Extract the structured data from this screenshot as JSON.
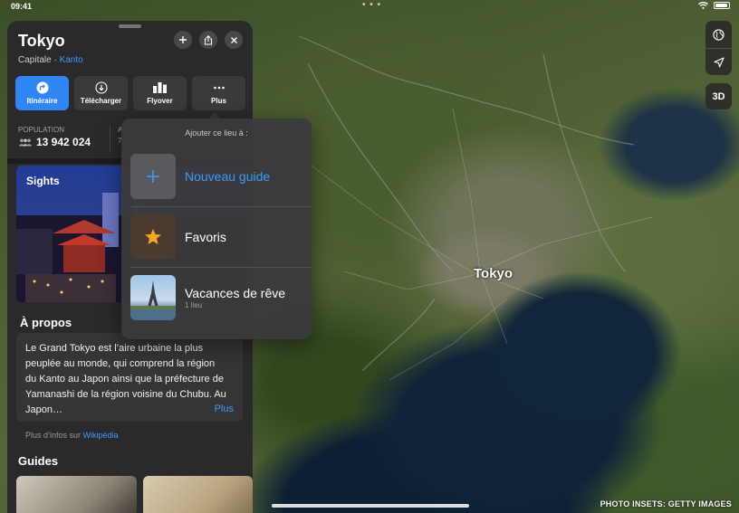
{
  "status_bar": {
    "time": "09:41",
    "dots": "• • •"
  },
  "map": {
    "city_label": "Tokyo",
    "credit": "PHOTO INSETS: GETTY IMAGES",
    "controls": {
      "globe_icon": "globe-icon",
      "location_icon": "location-arrow-icon",
      "view_3d_label": "3D"
    }
  },
  "place": {
    "title": "Tokyo",
    "subtitle_prefix": "Capitale · ",
    "subtitle_link": "Kanto",
    "actions": [
      {
        "label": "Itinéraire",
        "icon": "directions-icon",
        "primary": true
      },
      {
        "label": "Télécharger",
        "icon": "download-icon"
      },
      {
        "label": "Flyover",
        "icon": "flyover-icon"
      },
      {
        "label": "Plus",
        "icon": "more-icon"
      }
    ],
    "stats": {
      "population_label": "POPULATION",
      "population_value": "13 942 024",
      "second_label": "A",
      "second_value": "7"
    },
    "sights_label": "Sights",
    "about": {
      "title": "À propos",
      "text": "Le Grand Tokyo est l’aire urbaine la plus peuplée au monde, qui comprend la région du Kanto au Japon ainsi que la préfecture de Yamanashi de la région voisine du Chubu. Au Japon…",
      "more": "Plus"
    },
    "wiki_prefix": "Plus d’infos sur ",
    "wiki_link": "Wikipédia",
    "guides_title": "Guides"
  },
  "popover": {
    "title": "Ajouter ce lieu à :",
    "items": [
      {
        "label": "Nouveau guide",
        "sub": "",
        "icon": "plus-icon"
      },
      {
        "label": "Favoris",
        "sub": "",
        "icon": "star-icon"
      },
      {
        "label": "Vacances de rêve",
        "sub": "1 lieu",
        "icon": "eiffel-tower-thumbnail"
      }
    ]
  },
  "colors": {
    "accent": "#2f86f2",
    "link": "#3d9bf6",
    "star": "#f5a623",
    "card_bg": "#2a2a2c"
  }
}
